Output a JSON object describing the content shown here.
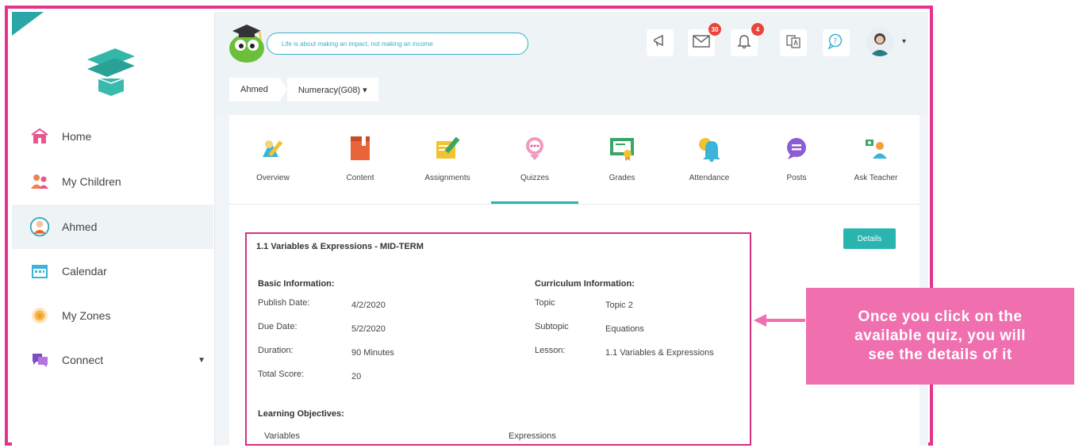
{
  "sidebar": {
    "items": [
      {
        "label": "Home",
        "icon": "home-icon"
      },
      {
        "label": "My Children",
        "icon": "children-icon"
      },
      {
        "label": "Ahmed",
        "icon": "student-avatar-icon"
      },
      {
        "label": "Calendar",
        "icon": "calendar-icon"
      },
      {
        "label": "My Zones",
        "icon": "zones-icon"
      },
      {
        "label": "Connect",
        "icon": "connect-icon"
      }
    ]
  },
  "header": {
    "quote": "Life is about making an impact, not making an income",
    "messages_count": "30",
    "notifications_count": "4"
  },
  "breadcrumb": {
    "student": "Ahmed",
    "course": "Numeracy(G08) ▾"
  },
  "tabs": [
    {
      "label": "Overview"
    },
    {
      "label": "Content"
    },
    {
      "label": "Assignments"
    },
    {
      "label": "Quizzes"
    },
    {
      "label": "Grades"
    },
    {
      "label": "Attendance"
    },
    {
      "label": "Posts"
    },
    {
      "label": "Ask Teacher"
    }
  ],
  "details_button": "Details",
  "quiz": {
    "title": "1.1 Variables & Expressions - MID-TERM",
    "basic_heading": "Basic Information:",
    "curriculum_heading": "Curriculum Information:",
    "publish_label": "Publish Date:",
    "publish_value": "4/2/2020",
    "due_label": "Due Date:",
    "due_value": "5/2/2020",
    "duration_label": "Duration:",
    "duration_value": "90 Minutes",
    "score_label": "Total Score:",
    "score_value": "20",
    "topic_label": "Topic",
    "topic_value": "Topic 2",
    "subtopic_label": "Subtopic",
    "subtopic_value": "Equations",
    "lesson_label": "Lesson:",
    "lesson_value": "1.1 Variables & Expressions",
    "objectives_heading": "Learning Objectives:",
    "objective_1": "Variables",
    "objective_2": "Expressions"
  },
  "callout": {
    "line1": "Once you click on the",
    "line2": "available quiz, you will",
    "line3": "see the details of it"
  },
  "colors": {
    "frame": "#e5338d",
    "accent": "#2ab4b0",
    "callout": "#f06faf"
  }
}
